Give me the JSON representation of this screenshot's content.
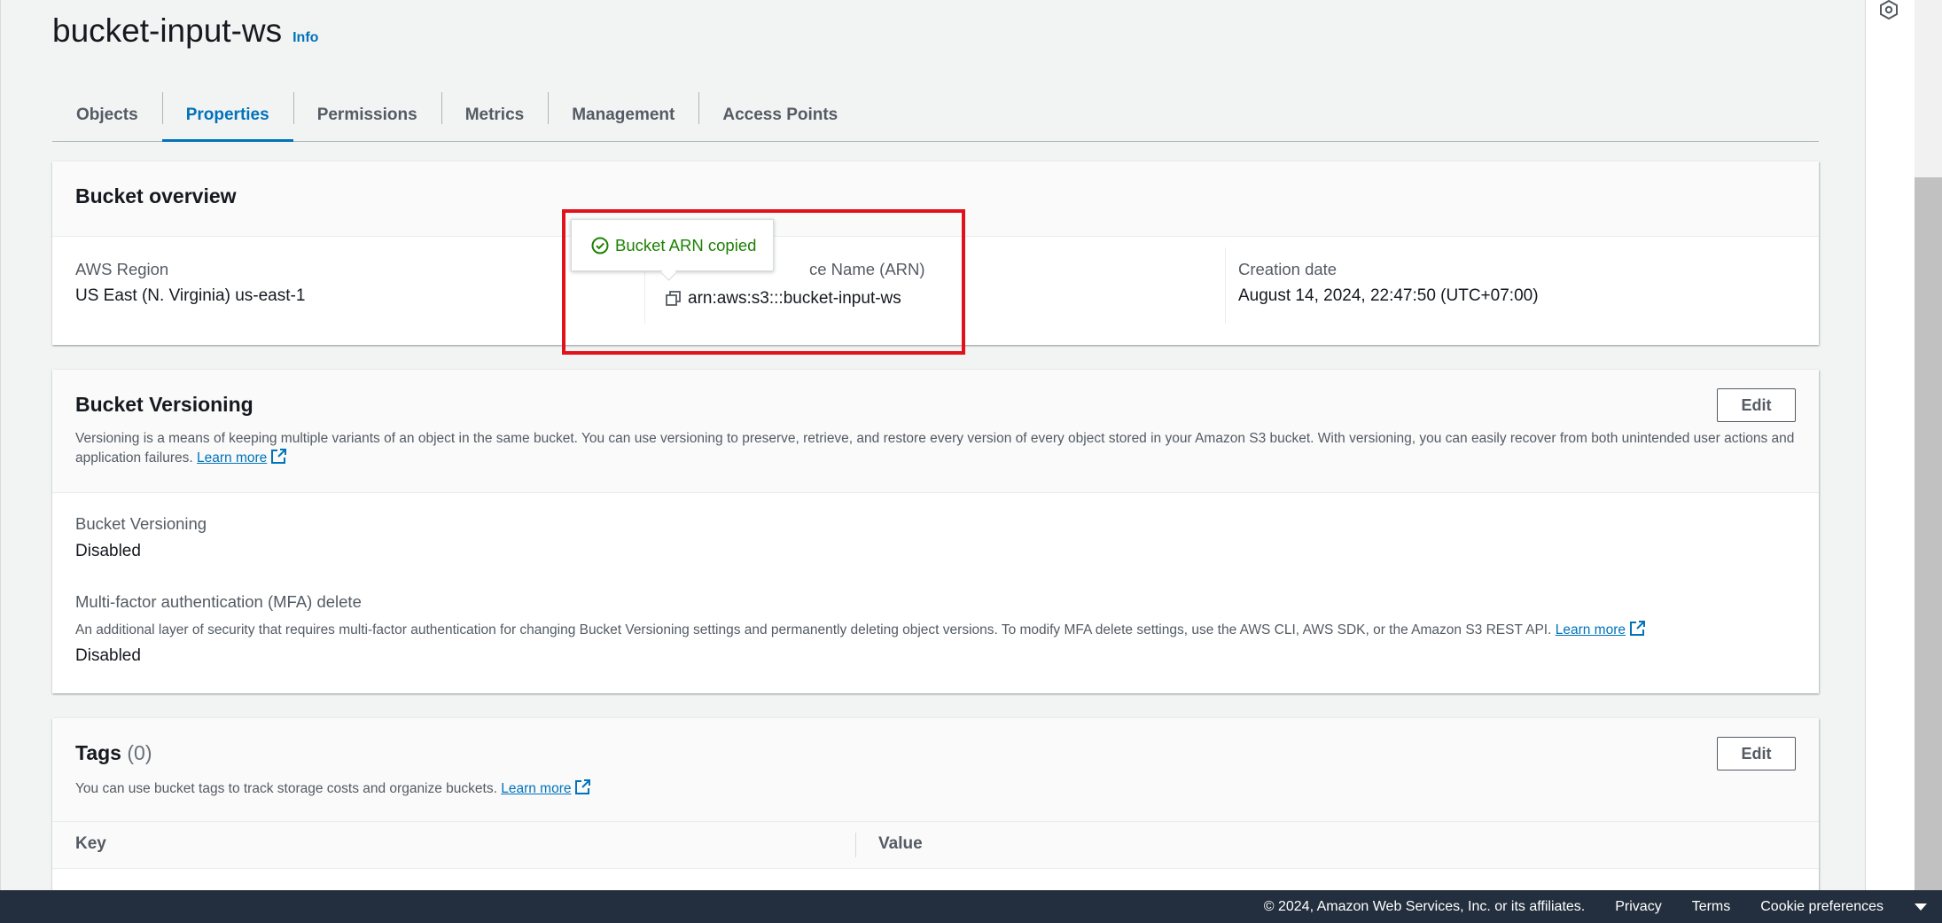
{
  "page": {
    "title": "bucket-input-ws",
    "info_link": "Info"
  },
  "tabs": [
    {
      "label": "Objects"
    },
    {
      "label": "Properties"
    },
    {
      "label": "Permissions"
    },
    {
      "label": "Metrics"
    },
    {
      "label": "Management"
    },
    {
      "label": "Access Points"
    }
  ],
  "overview": {
    "title": "Bucket overview",
    "region_label": "AWS Region",
    "region_value": "US East (N. Virginia) us-east-1",
    "arn_label_visible": "ce Name (ARN)",
    "arn_value": "arn:aws:s3:::bucket-input-ws",
    "created_label": "Creation date",
    "created_value": "August 14, 2024, 22:47:50 (UTC+07:00)"
  },
  "tooltip": {
    "text": "Bucket ARN copied"
  },
  "versioning": {
    "title": "Bucket Versioning",
    "edit_label": "Edit",
    "description": "Versioning is a means of keeping multiple variants of an object in the same bucket. You can use versioning to preserve, retrieve, and restore every version of every object stored in your Amazon S3 bucket. With versioning, you can easily recover from both unintended user actions and application failures.",
    "learn_more": "Learn more",
    "status_label": "Bucket Versioning",
    "status_value": "Disabled",
    "mfa_label": "Multi-factor authentication (MFA) delete",
    "mfa_description": "An additional layer of security that requires multi-factor authentication for changing Bucket Versioning settings and permanently deleting object versions. To modify MFA delete settings, use the AWS CLI, AWS SDK, or the Amazon S3 REST API.",
    "mfa_learn_more": "Learn more",
    "mfa_value": "Disabled"
  },
  "tags": {
    "title": "Tags",
    "count": "(0)",
    "edit_label": "Edit",
    "description": "You can use bucket tags to track storage costs and organize buckets.",
    "learn_more": "Learn more",
    "col_key": "Key",
    "col_value": "Value"
  },
  "footer": {
    "copyright": "© 2024, Amazon Web Services, Inc. or its affiliates.",
    "privacy": "Privacy",
    "terms": "Terms",
    "cookies": "Cookie preferences"
  },
  "colors": {
    "accent": "#0073bb",
    "success": "#1d8102",
    "highlight": "#e0121c",
    "footer_bg": "#232f3e"
  },
  "icons": [
    "settings-hex-icon",
    "copy-icon",
    "check-circle-icon",
    "external-link-icon",
    "caret-down-icon"
  ]
}
